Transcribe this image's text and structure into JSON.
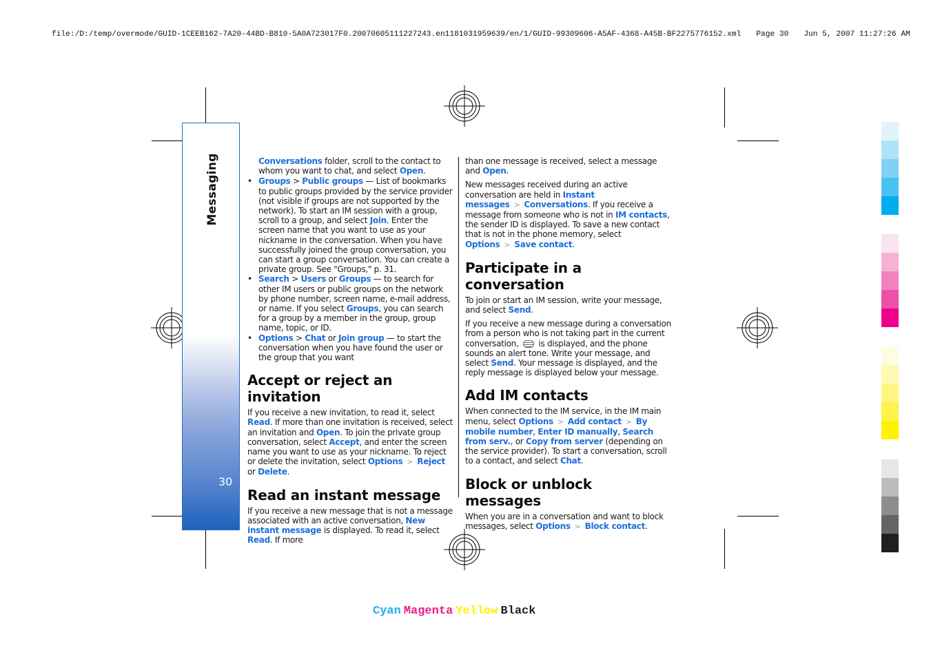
{
  "print_header": {
    "file_path": "file:/D:/temp/overmode/GUID-1CEEB162-7A20-44BD-B810-5A0A723017F0.20070605111227243.en1181031959639/en/1/GUID-99309606-A5AF-4368-A45B-BF2275776152.xml",
    "page": "Page 30",
    "datetime": "Jun 5, 2007 11:27:26 AM"
  },
  "sidebar": {
    "section_title": "Messaging",
    "page_number": "30"
  },
  "colors": {
    "link": "#1e6fd9",
    "sidebar_bottom": "#1e62bd"
  },
  "column1": {
    "intro": {
      "l1": "Conversations",
      "t1": " folder, scroll to the contact to whom you want to chat, and select ",
      "l2": "Open",
      "t2": "."
    },
    "bullets": [
      {
        "l1": "Groups",
        "t1": " > ",
        "l2": "Public groups",
        "t2": " — List of bookmarks to public groups provided by the service provider (not visible if groups are not supported by the network). To start an IM session with a group, scroll to a group, and select ",
        "l3": "Join",
        "t3": ". Enter the screen name that you want to use as your nickname in the conversation. When you have successfully joined the group conversation, you can start a group conversation. You can create a private group. See \"Groups,\" p. 31."
      },
      {
        "l1": "Search",
        "t1": " > ",
        "l2": "Users",
        "t2": " or ",
        "l3": "Groups",
        "t3": "  — to search for other IM users or public groups on the network by phone number, screen name, e-mail address, or name. If you select ",
        "l4": "Groups",
        "t4": ", you can search for a group by a member in the group, group name, topic, or ID."
      },
      {
        "l1": "Options",
        "t1": " > ",
        "l2": "Chat",
        "t2": " or ",
        "l3": "Join group",
        "t3": " — to start the conversation when you have found the user or the group that you want"
      }
    ],
    "accept": {
      "heading": "Accept or reject an invitation",
      "t1": "If you receive a new invitation, to read it, select ",
      "l1": "Read",
      "t2": ". If more than one invitation is received, select an invitation and ",
      "l2": "Open",
      "t3": ". To join the private group conversation, select ",
      "l3": "Accept",
      "t4": ", and enter the screen name you want to use as your nickname. To reject or delete the invitation, select ",
      "l4": "Options",
      "l5": "Reject",
      "t5": " or ",
      "l6": "Delete",
      "t6": "."
    },
    "read": {
      "heading": "Read an instant message",
      "t1": "If you receive a new message that is not a message associated with an active conversation, ",
      "l1": "New instant message",
      "t2": " is displayed. To read it, select ",
      "l2": "Read",
      "t3": ". If more"
    }
  },
  "column2": {
    "cont": {
      "t1": "than one message is received, select a message and ",
      "l1": "Open",
      "t2": "."
    },
    "new_msgs": {
      "t1": "New messages received during an active conversation are held in ",
      "l1": "Instant messages",
      "l2": "Conversations",
      "t2": ". If you receive a message from someone who is not in ",
      "l3": "IM contacts",
      "t3": ", the sender ID is displayed. To save a new contact that is not in the phone memory, select ",
      "l4": "Options",
      "l5": "Save contact",
      "t4": "."
    },
    "participate": {
      "heading": "Participate in a conversation",
      "p1": {
        "t1": "To join or start an IM session, write your message, and select ",
        "l1": "Send",
        "t2": "."
      },
      "p2": {
        "t1": "If you receive a new message during a conversation from a person who is not taking part in the current conversation, ",
        "icon": "new-message-icon",
        "t2": " is displayed, and the phone sounds an alert tone. Write your message, and select ",
        "l1": "Send",
        "t3": ". Your message is displayed, and the reply message is displayed below your message."
      }
    },
    "add": {
      "heading": "Add IM contacts",
      "t1": "When connected to the IM service, in the IM main menu, select ",
      "l1": "Options",
      "l2": "Add contact",
      "l3": "By mobile number",
      "t2": ", ",
      "l4": "Enter ID manually",
      "t3": ", ",
      "l5": "Search from serv.",
      "t4": ", or ",
      "l6": "Copy from server",
      "t5": " (depending on the service provider). To start a conversation, scroll to a contact, and select ",
      "l7": "Chat",
      "t6": "."
    },
    "block": {
      "heading": "Block or unblock messages",
      "t1": "When you are in a conversation and want to block messages, select ",
      "l1": "Options",
      "l2": "Block contact",
      "t2": "."
    },
    "sep": ">"
  },
  "color_bars": {
    "cyan": [
      "#e1f4fc",
      "#b0e3f8",
      "#7fd2f4",
      "#4ac2f0",
      "#00aeef"
    ],
    "magenta": [
      "#fce3f0",
      "#f7b1d6",
      "#f281bf",
      "#ee4fa7",
      "#ec008c"
    ],
    "yellow": [
      "#fffde1",
      "#fff9b1",
      "#fff680",
      "#fff34b",
      "#fff200"
    ],
    "black": [
      "#e6e6e6",
      "#bcbcbc",
      "#8d8d8d",
      "#656565",
      "#231f20"
    ]
  },
  "cmyk_label": [
    {
      "text": "Cyan",
      "color": "#22aeef"
    },
    {
      "text": "Magenta",
      "color": "#ec1c8c"
    },
    {
      "text": "Yellow",
      "color": "#fff200"
    },
    {
      "text": "Black",
      "color": "#231f20"
    }
  ]
}
